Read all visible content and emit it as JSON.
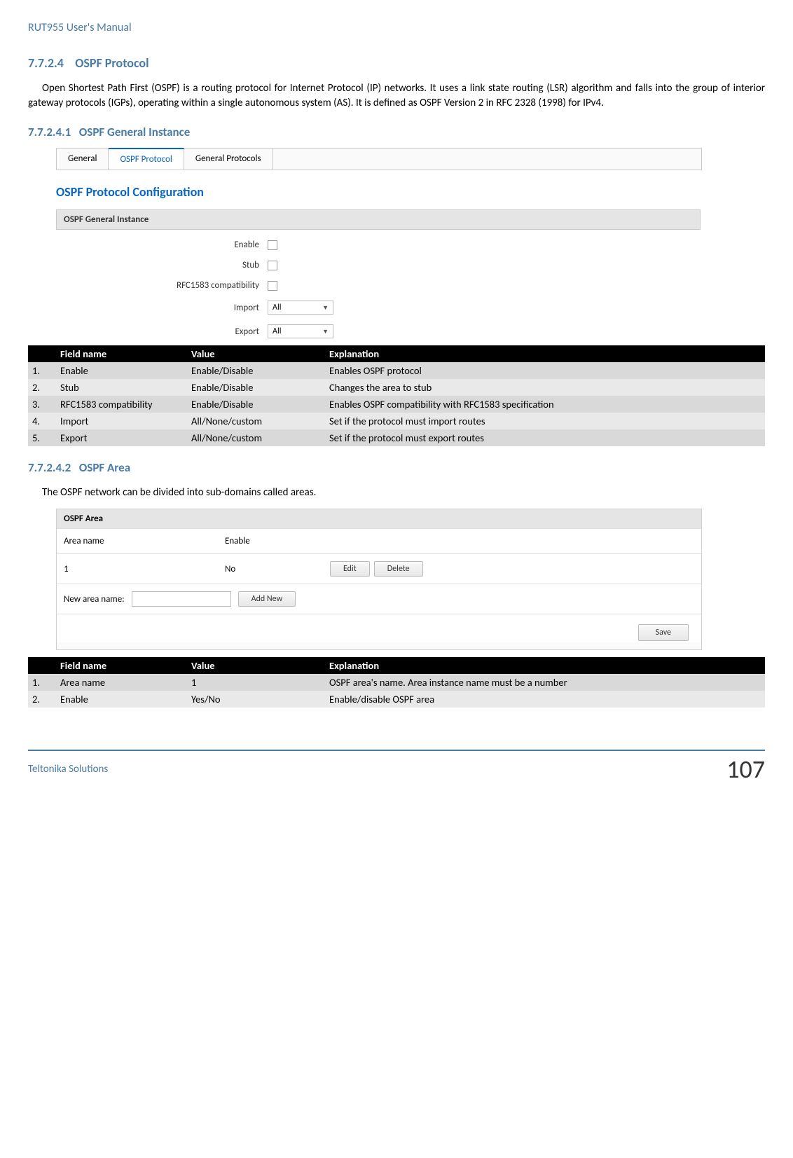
{
  "doc_header": "RUT955 User's Manual",
  "h3": {
    "num": "7.7.2.4",
    "title": "OSPF Protocol"
  },
  "intro_para": "Open Shortest Path First (OSPF) is a routing protocol for Internet Protocol (IP) networks. It uses a link state routing (LSR) algorithm and falls into the group of interior gateway protocols (IGPs), operating within a single autonomous system (AS). It is defined as OSPF Version 2 in RFC 2328 (1998) for IPv4.",
  "h4a": {
    "num": "7.7.2.4.1",
    "title": "OSPF General Instance"
  },
  "tabs": {
    "general": "General",
    "ospf": "OSPF Protocol",
    "genprot": "General Protocols"
  },
  "config_title": "OSPF Protocol Configuration",
  "section_band": "OSPF General Instance",
  "form": {
    "enable": "Enable",
    "stub": "Stub",
    "rfc": "RFC1583 compatibility",
    "import": "Import",
    "export": "Export",
    "select_all": "All"
  },
  "table1_head": {
    "field": "Field name",
    "value": "Value",
    "expl": "Explanation"
  },
  "table1": [
    {
      "n": "1.",
      "f": "Enable",
      "v": "Enable/Disable",
      "e": "Enables OSPF protocol"
    },
    {
      "n": "2.",
      "f": "Stub",
      "v": "Enable/Disable",
      "e": "Changes the area to stub"
    },
    {
      "n": "3.",
      "f": "RFC1583 compatibility",
      "v": "Enable/Disable",
      "e": "Enables OSPF compatibility with RFC1583 specification"
    },
    {
      "n": "4.",
      "f": "Import",
      "v": "All/None/custom",
      "e": "Set if the protocol must import routes"
    },
    {
      "n": "5.",
      "f": "Export",
      "v": "All/None/custom",
      "e": "Set if the protocol must export routes"
    }
  ],
  "h4b": {
    "num": "7.7.2.4.2",
    "title": "OSPF Area"
  },
  "area_para": "The OSPF network can be divided into sub-domains called areas.",
  "area_panel": {
    "title": "OSPF Area",
    "col_name": "Area name",
    "col_enable": "Enable",
    "row_name": "1",
    "row_enable": "No",
    "edit": "Edit",
    "delete": "Delete",
    "new_label": "New area name:",
    "add_new": "Add New",
    "save": "Save"
  },
  "table2": [
    {
      "n": "1.",
      "f": "Area name",
      "v": "1",
      "e": "OSPF area's name. Area instance name must be a number"
    },
    {
      "n": "2.",
      "f": "Enable",
      "v": "Yes/No",
      "e": "Enable/disable OSPF area"
    }
  ],
  "footer": {
    "left": "Teltonika Solutions",
    "right": "107"
  }
}
